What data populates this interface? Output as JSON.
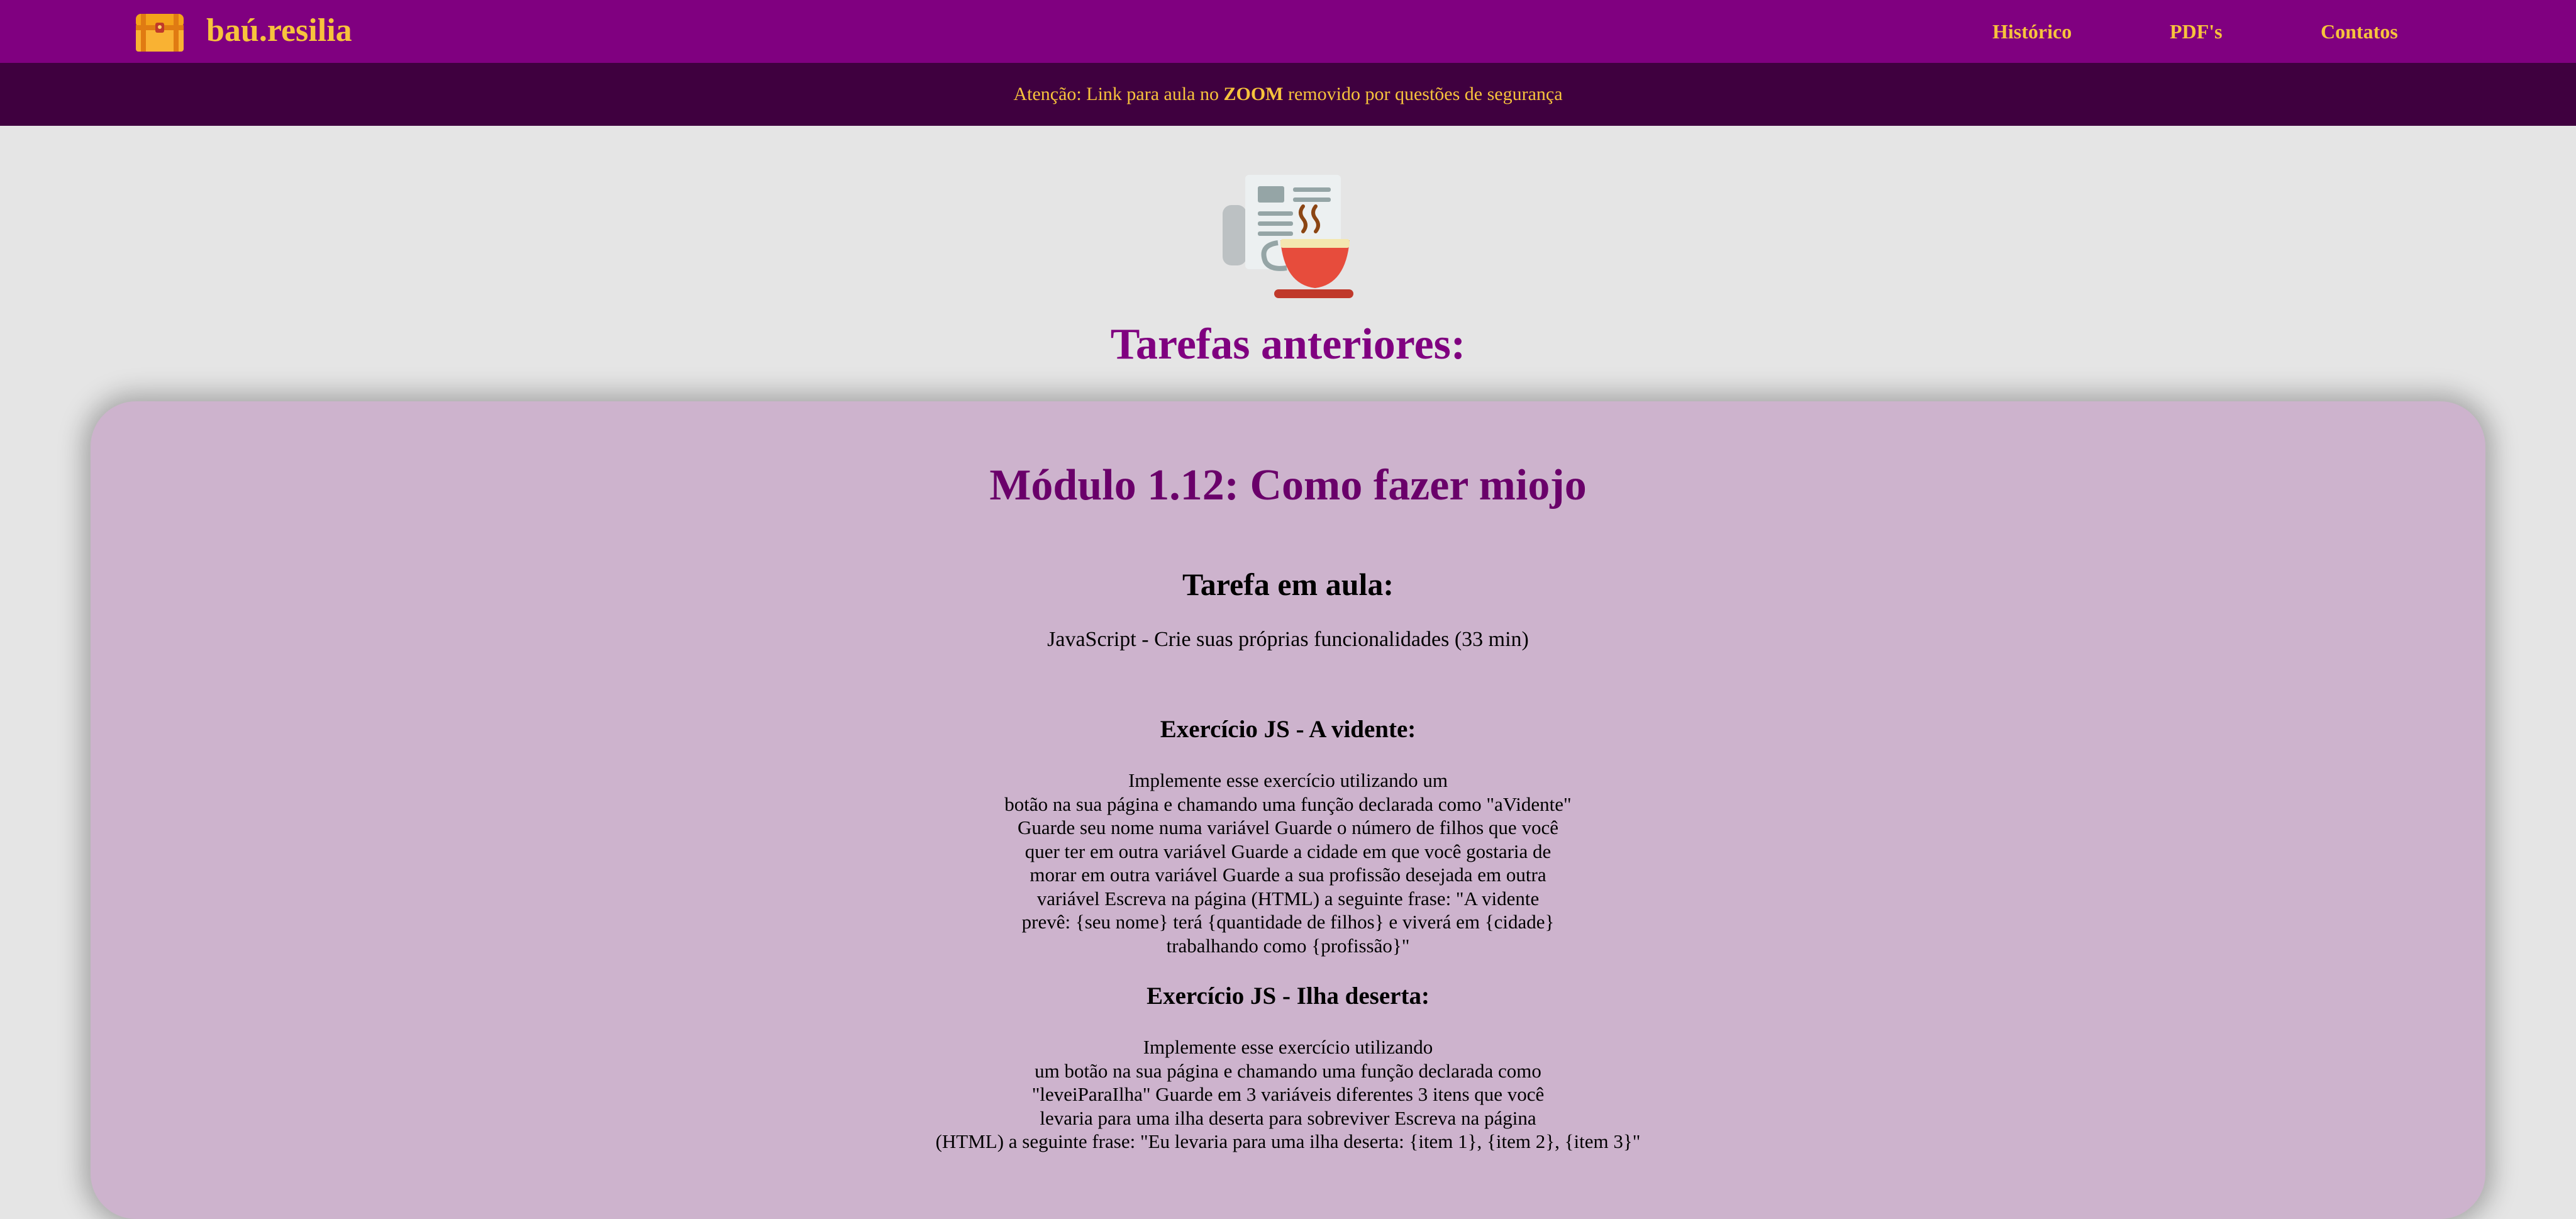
{
  "header": {
    "brand": "baú.resilia",
    "nav": [
      {
        "label": "Histórico"
      },
      {
        "label": "PDF's"
      },
      {
        "label": "Contatos"
      }
    ]
  },
  "alert": {
    "prefix": "Atenção: Link para aula no ",
    "highlight": "ZOOM",
    "suffix": " removido por questões de segurança"
  },
  "page": {
    "title": "Tarefas anteriores:"
  },
  "card": {
    "module_title": "Módulo 1.12: Como fazer miojo",
    "task_heading": "Tarefa em aula:",
    "task_text": "JavaScript - Crie suas próprias funcionalidades (33 min)",
    "exercises": [
      {
        "title": "Exercício JS - A vidente:",
        "lines": [
          "Implemente esse exercício utilizando um",
          "botão na sua página e chamando uma função declarada como \"aVidente\"",
          "Guarde seu nome numa variável Guarde o número de filhos que você",
          "quer ter em outra variável Guarde a cidade em que você gostaria de",
          "morar em outra variável Guarde a sua profissão desejada em outra",
          "variável Escreva na página (HTML) a seguinte frase: \"A vidente",
          "prevê: {seu nome} terá {quantidade de filhos} e viverá em {cidade}",
          "trabalhando como {profissão}\""
        ]
      },
      {
        "title": "Exercício JS - Ilha deserta:",
        "lines": [
          "Implemente esse exercício utilizando",
          "um botão na sua página e chamando uma função declarada como",
          "\"leveiParaIlha\" Guarde em 3 variáveis diferentes 3 itens que você",
          "levaria para uma ilha deserta para sobreviver Escreva na página",
          "(HTML) a seguinte frase: \"Eu levaria para uma ilha deserta: {item 1}, {item 2}, {item 3}\""
        ]
      }
    ]
  },
  "colors": {
    "nav_bg": "#800080",
    "alert_bg": "#3f003f",
    "accent_text": "#f7c33c",
    "card_bg": "#cdb3cd",
    "module_title": "#6a006a",
    "page_bg": "#e5e5e5"
  },
  "icons": {
    "brand": "treasure-chest-icon",
    "hero": "newspaper-coffee-icon"
  }
}
